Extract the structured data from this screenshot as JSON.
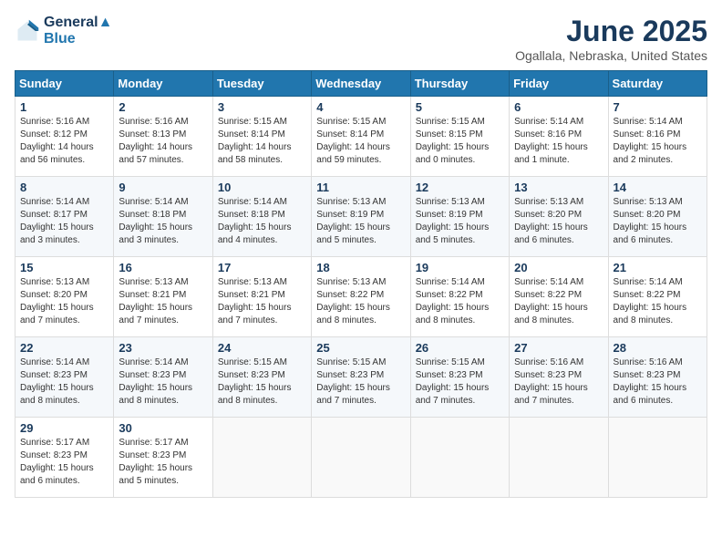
{
  "logo": {
    "line1": "General",
    "line2": "Blue"
  },
  "title": "June 2025",
  "location": "Ogallala, Nebraska, United States",
  "days_of_week": [
    "Sunday",
    "Monday",
    "Tuesday",
    "Wednesday",
    "Thursday",
    "Friday",
    "Saturday"
  ],
  "weeks": [
    [
      {
        "day": "1",
        "sunrise": "5:16 AM",
        "sunset": "8:12 PM",
        "daylight": "14 hours and 56 minutes."
      },
      {
        "day": "2",
        "sunrise": "5:16 AM",
        "sunset": "8:13 PM",
        "daylight": "14 hours and 57 minutes."
      },
      {
        "day": "3",
        "sunrise": "5:15 AM",
        "sunset": "8:14 PM",
        "daylight": "14 hours and 58 minutes."
      },
      {
        "day": "4",
        "sunrise": "5:15 AM",
        "sunset": "8:14 PM",
        "daylight": "14 hours and 59 minutes."
      },
      {
        "day": "5",
        "sunrise": "5:15 AM",
        "sunset": "8:15 PM",
        "daylight": "15 hours and 0 minutes."
      },
      {
        "day": "6",
        "sunrise": "5:14 AM",
        "sunset": "8:16 PM",
        "daylight": "15 hours and 1 minute."
      },
      {
        "day": "7",
        "sunrise": "5:14 AM",
        "sunset": "8:16 PM",
        "daylight": "15 hours and 2 minutes."
      }
    ],
    [
      {
        "day": "8",
        "sunrise": "5:14 AM",
        "sunset": "8:17 PM",
        "daylight": "15 hours and 3 minutes."
      },
      {
        "day": "9",
        "sunrise": "5:14 AM",
        "sunset": "8:18 PM",
        "daylight": "15 hours and 3 minutes."
      },
      {
        "day": "10",
        "sunrise": "5:14 AM",
        "sunset": "8:18 PM",
        "daylight": "15 hours and 4 minutes."
      },
      {
        "day": "11",
        "sunrise": "5:13 AM",
        "sunset": "8:19 PM",
        "daylight": "15 hours and 5 minutes."
      },
      {
        "day": "12",
        "sunrise": "5:13 AM",
        "sunset": "8:19 PM",
        "daylight": "15 hours and 5 minutes."
      },
      {
        "day": "13",
        "sunrise": "5:13 AM",
        "sunset": "8:20 PM",
        "daylight": "15 hours and 6 minutes."
      },
      {
        "day": "14",
        "sunrise": "5:13 AM",
        "sunset": "8:20 PM",
        "daylight": "15 hours and 6 minutes."
      }
    ],
    [
      {
        "day": "15",
        "sunrise": "5:13 AM",
        "sunset": "8:20 PM",
        "daylight": "15 hours and 7 minutes."
      },
      {
        "day": "16",
        "sunrise": "5:13 AM",
        "sunset": "8:21 PM",
        "daylight": "15 hours and 7 minutes."
      },
      {
        "day": "17",
        "sunrise": "5:13 AM",
        "sunset": "8:21 PM",
        "daylight": "15 hours and 7 minutes."
      },
      {
        "day": "18",
        "sunrise": "5:13 AM",
        "sunset": "8:22 PM",
        "daylight": "15 hours and 8 minutes."
      },
      {
        "day": "19",
        "sunrise": "5:14 AM",
        "sunset": "8:22 PM",
        "daylight": "15 hours and 8 minutes."
      },
      {
        "day": "20",
        "sunrise": "5:14 AM",
        "sunset": "8:22 PM",
        "daylight": "15 hours and 8 minutes."
      },
      {
        "day": "21",
        "sunrise": "5:14 AM",
        "sunset": "8:22 PM",
        "daylight": "15 hours and 8 minutes."
      }
    ],
    [
      {
        "day": "22",
        "sunrise": "5:14 AM",
        "sunset": "8:23 PM",
        "daylight": "15 hours and 8 minutes."
      },
      {
        "day": "23",
        "sunrise": "5:14 AM",
        "sunset": "8:23 PM",
        "daylight": "15 hours and 8 minutes."
      },
      {
        "day": "24",
        "sunrise": "5:15 AM",
        "sunset": "8:23 PM",
        "daylight": "15 hours and 8 minutes."
      },
      {
        "day": "25",
        "sunrise": "5:15 AM",
        "sunset": "8:23 PM",
        "daylight": "15 hours and 7 minutes."
      },
      {
        "day": "26",
        "sunrise": "5:15 AM",
        "sunset": "8:23 PM",
        "daylight": "15 hours and 7 minutes."
      },
      {
        "day": "27",
        "sunrise": "5:16 AM",
        "sunset": "8:23 PM",
        "daylight": "15 hours and 7 minutes."
      },
      {
        "day": "28",
        "sunrise": "5:16 AM",
        "sunset": "8:23 PM",
        "daylight": "15 hours and 6 minutes."
      }
    ],
    [
      {
        "day": "29",
        "sunrise": "5:17 AM",
        "sunset": "8:23 PM",
        "daylight": "15 hours and 6 minutes."
      },
      {
        "day": "30",
        "sunrise": "5:17 AM",
        "sunset": "8:23 PM",
        "daylight": "15 hours and 5 minutes."
      },
      null,
      null,
      null,
      null,
      null
    ]
  ]
}
